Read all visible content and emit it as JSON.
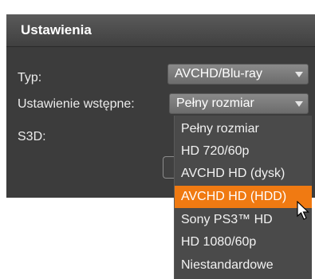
{
  "panel": {
    "title": "Ustawienia"
  },
  "fields": {
    "type_label": "Typ:",
    "type_value": "AVCHD/Blu-ray",
    "preset_label": "Ustawienie wstępne:",
    "preset_value": "Pełny rozmiar",
    "s3d_label": "S3D:"
  },
  "dropdown": {
    "items": [
      "Pełny rozmiar",
      "HD 720/60p",
      "AVCHD HD (dysk)",
      "AVCHD HD (HDD)",
      "Sony PS3™ HD",
      "HD 1080/60p",
      "Niestandardowe"
    ],
    "highlighted": "AVCHD HD (HDD)"
  },
  "colors": {
    "panel_bg": "#3c3c3c",
    "highlight": "#f07a12"
  },
  "icons": [
    "chevron-down-icon",
    "mouse-pointer-icon"
  ]
}
